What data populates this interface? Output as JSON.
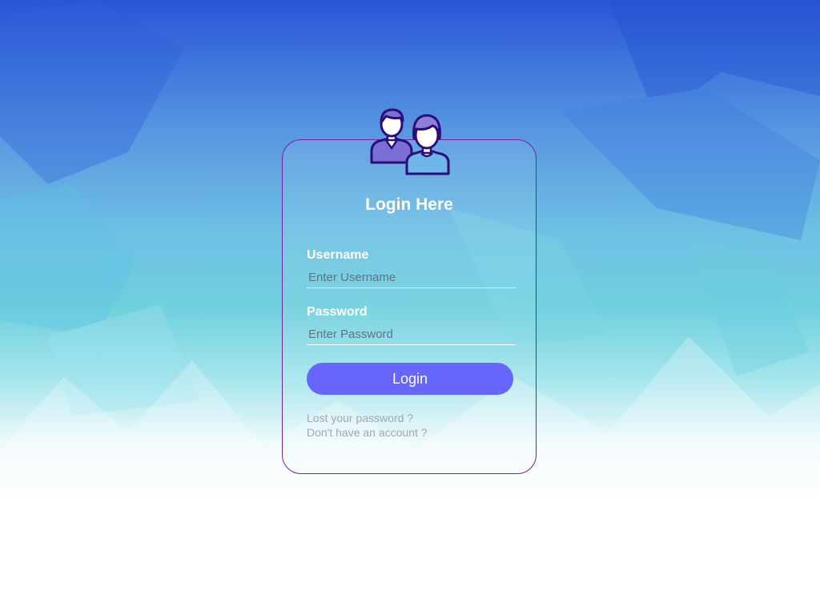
{
  "login": {
    "title": "Login Here",
    "username": {
      "label": "Username",
      "placeholder": "Enter Username",
      "value": ""
    },
    "password": {
      "label": "Password",
      "placeholder": "Enter Password",
      "value": ""
    },
    "submit_label": "Login",
    "links": {
      "lost_password": "Lost your password ?",
      "no_account": "Don't have an account ?"
    }
  },
  "icons": {
    "avatar": "users-icon"
  },
  "colors": {
    "button": "#6666ff",
    "box_border": "#7b1fa2",
    "text": "#ffffff",
    "link": "#a0a8ad",
    "icon_outline": "#2a0e7a",
    "icon_fill": "#7b6fd6"
  }
}
